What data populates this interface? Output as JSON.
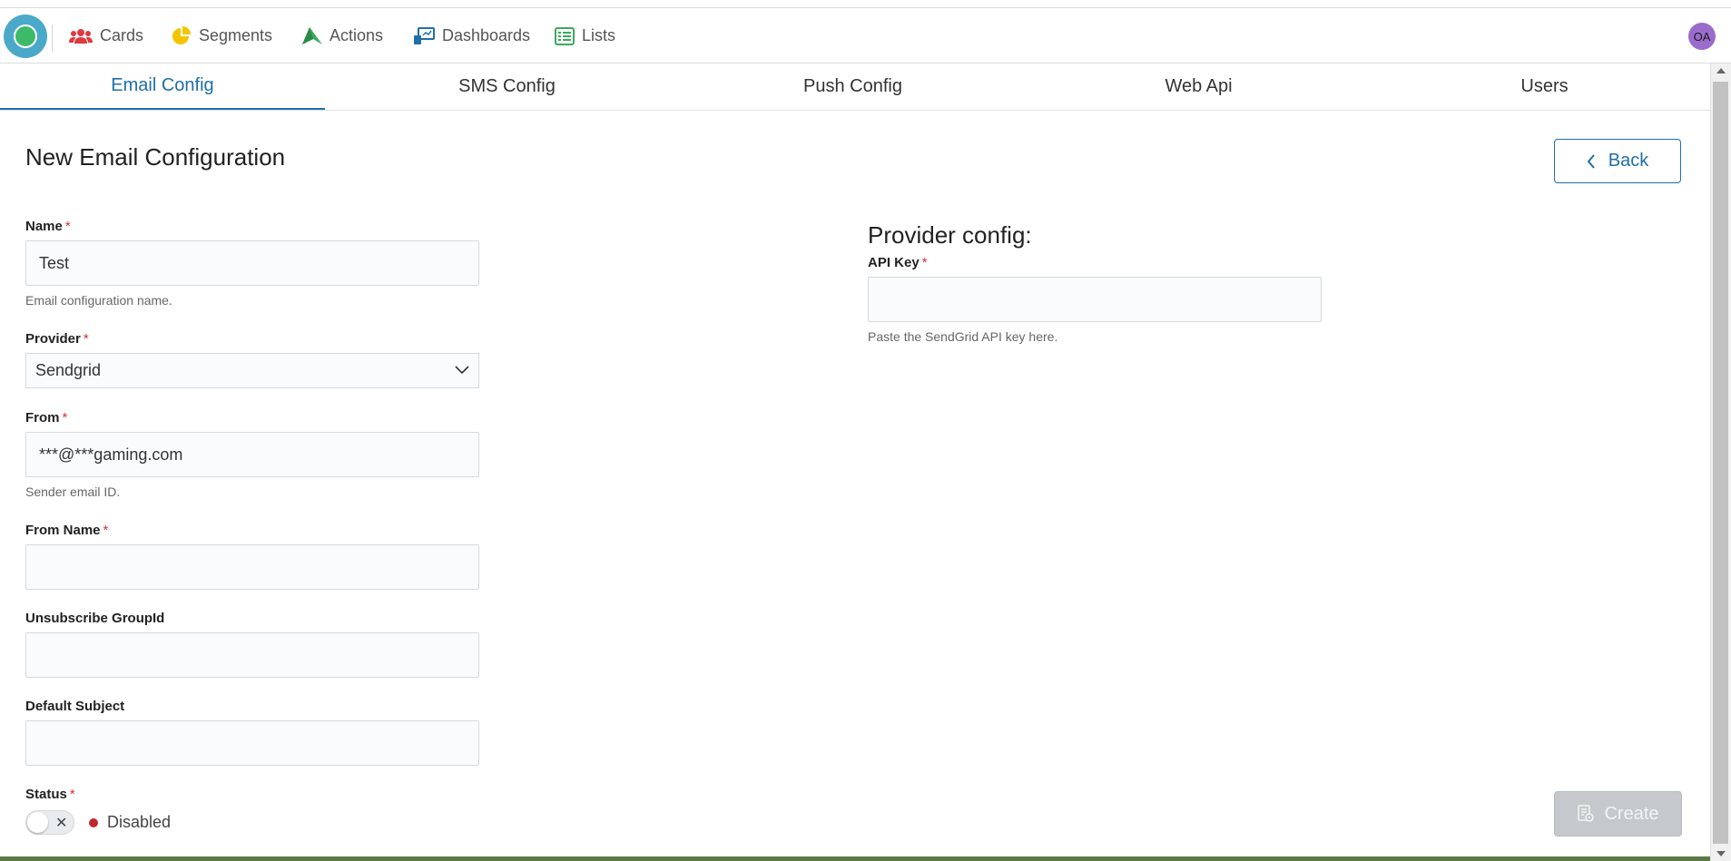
{
  "nav": {
    "items": [
      {
        "label": "Cards",
        "icon": "users-icon",
        "color": "#e0393e"
      },
      {
        "label": "Segments",
        "icon": "pie-chart-icon",
        "color": "#f5c400"
      },
      {
        "label": "Actions",
        "icon": "paper-plane-icon",
        "color": "#3aaa5c"
      },
      {
        "label": "Dashboards",
        "icon": "dashboard-icon",
        "color": "#1f6fa8"
      },
      {
        "label": "Lists",
        "icon": "list-icon",
        "color": "#3aaa5c"
      }
    ],
    "avatar_initials": "OA",
    "avatar_color": "#9b6ccc"
  },
  "tabs": [
    {
      "label": "Email Config",
      "active": true
    },
    {
      "label": "SMS Config",
      "active": false
    },
    {
      "label": "Push Config",
      "active": false
    },
    {
      "label": "Web Api",
      "active": false
    },
    {
      "label": "Users",
      "active": false
    }
  ],
  "page": {
    "title": "New Email Configuration",
    "back_label": "Back",
    "create_label": "Create"
  },
  "form": {
    "name": {
      "label": "Name",
      "required": "*",
      "value": "Test",
      "help": "Email configuration name."
    },
    "provider": {
      "label": "Provider",
      "required": "*",
      "value": "Sendgrid"
    },
    "from": {
      "label": "From",
      "required": "*",
      "value": "***@***gaming.com",
      "help": "Sender email ID."
    },
    "from_name": {
      "label": "From Name",
      "required": "*",
      "value": ""
    },
    "unsubscribe": {
      "label": "Unsubscribe GroupId",
      "value": ""
    },
    "default_subject": {
      "label": "Default Subject",
      "value": ""
    },
    "status": {
      "label": "Status",
      "required": "*",
      "value": "Disabled",
      "toggle_glyph": "✕"
    }
  },
  "provider_config": {
    "title": "Provider config:",
    "api_key": {
      "label": "API Key",
      "required": "*",
      "value": "",
      "help": "Paste the SendGrid API key here."
    }
  },
  "colors": {
    "accent": "#1f6fa8",
    "required": "#d9312a",
    "disabled_status": "#c0282b"
  }
}
